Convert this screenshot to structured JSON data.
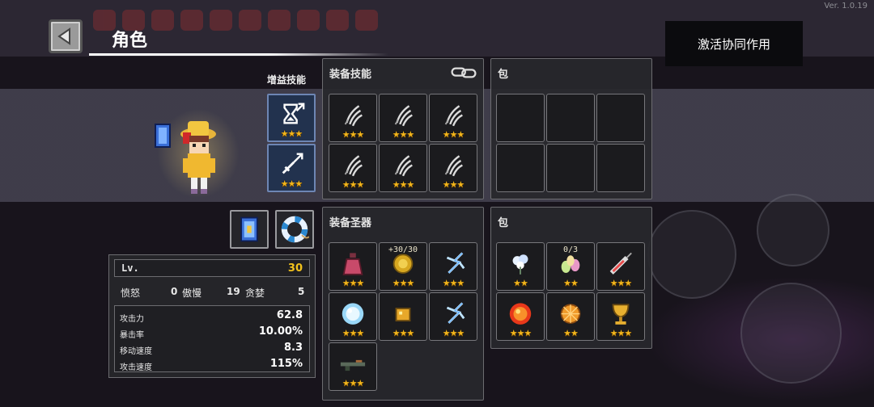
{
  "version": "Ver. 1.0.19",
  "header": {
    "title": "角色",
    "back_icon": "triangle-left-icon",
    "synergy_label": "激活协同作用"
  },
  "buff_skills": {
    "label": "增益技能",
    "slots": [
      {
        "icon": "hourglass-arrow-icon",
        "stars": "★★★"
      },
      {
        "icon": "sword-arrow-icon",
        "stars": "★★★"
      }
    ]
  },
  "equip_skills": {
    "title": "装备技能",
    "link_icon": "chain-link-icon",
    "slots": [
      {
        "icon": "claw-skill-icon",
        "stars": "★★★"
      },
      {
        "icon": "claw-skill-icon",
        "stars": "★★★"
      },
      {
        "icon": "claw-skill-icon",
        "stars": "★★★"
      },
      {
        "icon": "claw-skill-icon",
        "stars": "★★★"
      },
      {
        "icon": "claw-skill-icon",
        "stars": "★★★"
      },
      {
        "icon": "claw-skill-icon",
        "stars": "★★★"
      }
    ]
  },
  "skill_bag": {
    "title": "包"
  },
  "equip_relics": {
    "title": "装备圣器",
    "slots": [
      {
        "icon": "potion-icon",
        "stars": "★★★",
        "top": ""
      },
      {
        "icon": "gold-coin-icon",
        "stars": "★★★",
        "top": "+30/30"
      },
      {
        "icon": "lightning-icon",
        "stars": "★★★",
        "top": ""
      },
      {
        "icon": "ice-crystal-icon",
        "stars": "★★★",
        "top": ""
      },
      {
        "icon": "gold-cube-icon",
        "stars": "★★★",
        "top": ""
      },
      {
        "icon": "lightning-icon",
        "stars": "★★★",
        "top": ""
      },
      {
        "icon": "rifle-icon",
        "stars": "★★★",
        "top": ""
      }
    ]
  },
  "relic_bag": {
    "title": "包",
    "slots": [
      {
        "icon": "flower-icon",
        "stars": "★★",
        "top": ""
      },
      {
        "icon": "eggs-icon",
        "stars": "★★",
        "top": "0/3"
      },
      {
        "icon": "syringe-icon",
        "stars": "★★★",
        "top": ""
      },
      {
        "icon": "fire-orb-icon",
        "stars": "★★★",
        "top": ""
      },
      {
        "icon": "orange-slice-icon",
        "stars": "★★",
        "top": ""
      },
      {
        "icon": "golden-chalice-icon",
        "stars": "★★★",
        "top": ""
      }
    ]
  },
  "equipment": [
    {
      "icon": "spellbook-icon"
    },
    {
      "icon": "lifebuoy-icon"
    }
  ],
  "stats": {
    "lv_label": "Lv.",
    "lv": "30",
    "sins": [
      {
        "name": "愤怒",
        "value": "0"
      },
      {
        "name": "傲慢",
        "value": "19"
      },
      {
        "name": "贪婪",
        "value": "5"
      }
    ],
    "attrs": [
      {
        "name": "攻击力",
        "value": "62.8"
      },
      {
        "name": "暴击率",
        "value": "10.00%"
      },
      {
        "name": "移动速度",
        "value": "8.3"
      },
      {
        "name": "攻击速度",
        "value": "115%"
      }
    ]
  },
  "colors": {
    "star": "#f2b51c",
    "level": "#f2c21c",
    "panel": "#28282c",
    "border": "#6c6c70"
  }
}
